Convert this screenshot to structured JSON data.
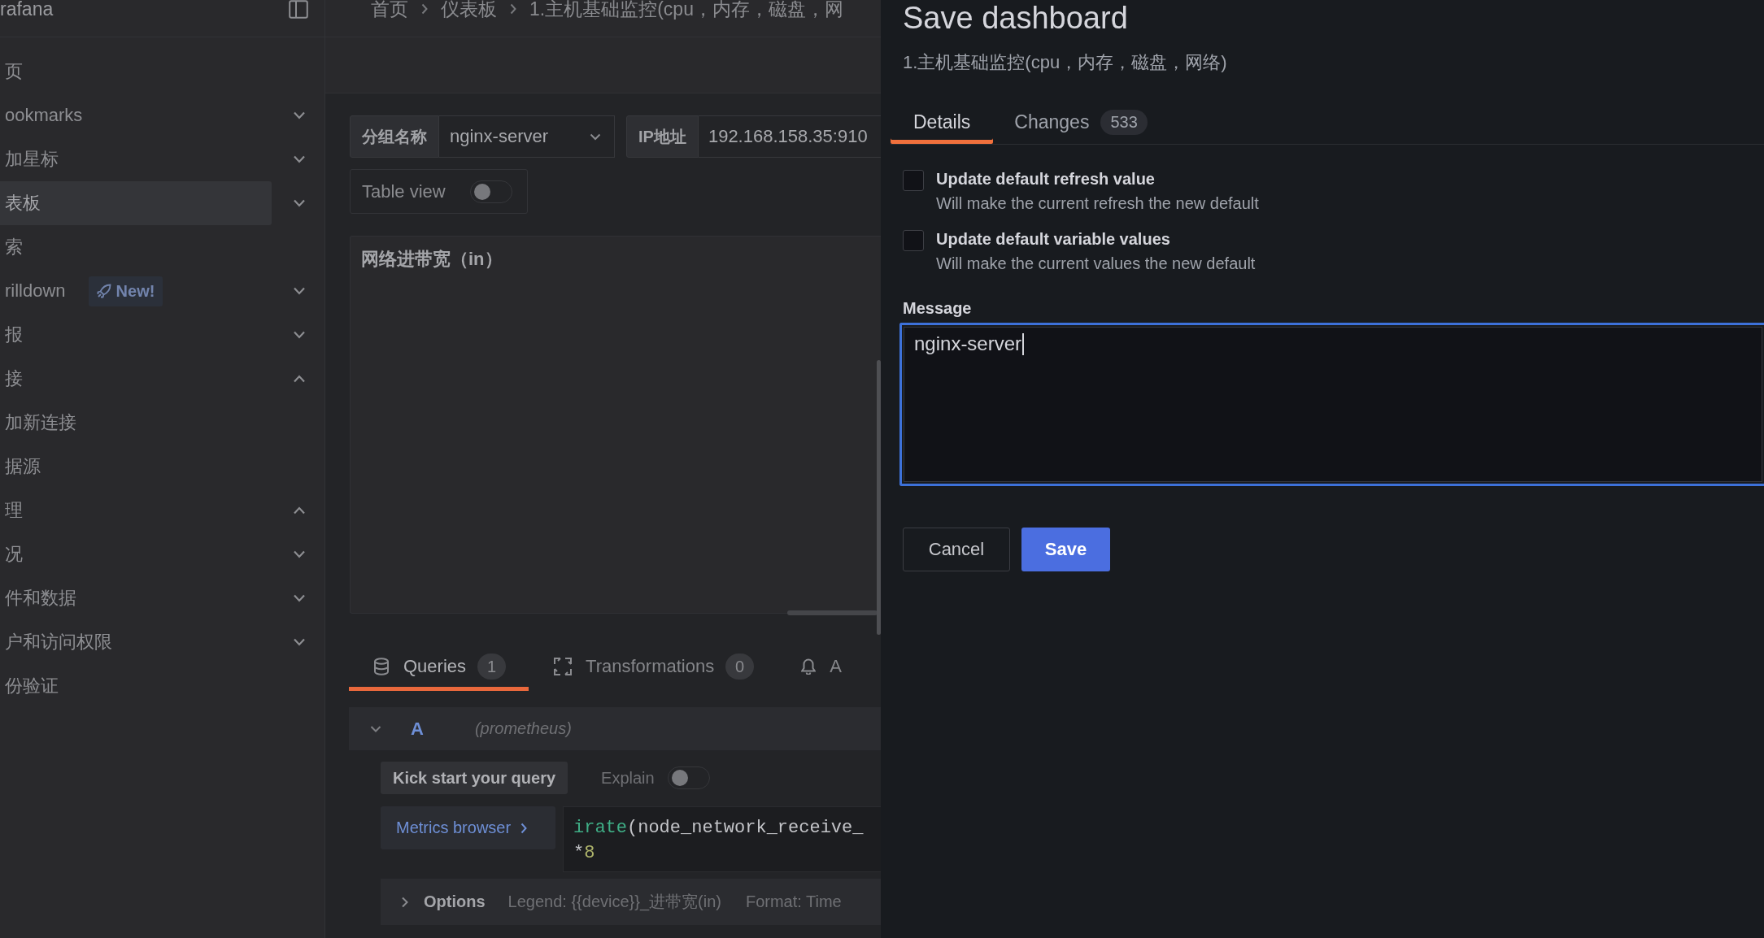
{
  "sidebar": {
    "brand": "rafana",
    "items": [
      {
        "label": "页",
        "selected": false
      },
      {
        "label": "ookmarks",
        "selected": false,
        "expanded": false
      },
      {
        "label": "加星标",
        "selected": false,
        "expanded": false
      },
      {
        "label": "表板",
        "selected": true,
        "expanded": false
      },
      {
        "label": "索",
        "selected": false
      },
      {
        "label": "rilldown",
        "selected": false,
        "expanded": false,
        "badge": "New!"
      },
      {
        "label": "报",
        "selected": false,
        "expanded": false
      },
      {
        "label": "接",
        "selected": false,
        "expanded": true,
        "children": [
          {
            "label": "加新连接",
            "selected": false
          },
          {
            "label": "据源",
            "selected": false
          }
        ]
      },
      {
        "label": "理",
        "selected": false,
        "expanded": true,
        "children": [
          {
            "label": "况",
            "selected": false,
            "expanded": false
          },
          {
            "label": "件和数据",
            "selected": false,
            "expanded": false
          },
          {
            "label": "户和访问权限",
            "selected": false,
            "expanded": false
          },
          {
            "label": "份验证",
            "selected": false
          }
        ]
      }
    ]
  },
  "breadcrumbs": [
    "首页",
    "仪表板",
    "1.主机基础监控(cpu，内存，磁盘，网"
  ],
  "variables": [
    {
      "kind": "dropdown",
      "label": "分组名称",
      "value": "nginx-server"
    },
    {
      "kind": "text",
      "label": "IP地址",
      "value": "192.168.158.35:910"
    }
  ],
  "table_view": {
    "label": "Table view",
    "on": false
  },
  "panel": {
    "title": "网络进带宽（in）"
  },
  "editor_tabs": [
    {
      "label": "Queries",
      "count": "1",
      "selected": true
    },
    {
      "label": "Transformations",
      "count": "0",
      "selected": false
    },
    {
      "label": "A",
      "selected": false
    }
  ],
  "query": {
    "ref": "A",
    "datasource": "(prometheus)",
    "expanded": true,
    "kick_start": "Kick start your query",
    "explain": {
      "label": "Explain",
      "on": false
    },
    "metrics_browser": "Metrics browser",
    "code": [
      [
        {
          "kind": "function",
          "text": "irate"
        },
        {
          "kind": "plain",
          "text": "(node_network_receive_"
        }
      ],
      [
        {
          "kind": "plain",
          "text": "*"
        },
        {
          "kind": "number",
          "text": "8"
        }
      ]
    ],
    "options": {
      "label": "Options",
      "expanded": false,
      "legend": "Legend: {{device}}_进带宽(in)",
      "format": "Format: Time"
    }
  },
  "drawer": {
    "title": "Save dashboard",
    "subtitle": "1.主机基础监控(cpu，内存，磁盘，网络)",
    "tabs": [
      {
        "label": "Details",
        "selected": true
      },
      {
        "label": "Changes",
        "count": "533",
        "selected": false
      }
    ],
    "options": [
      {
        "label": "Update default refresh value",
        "description": "Will make the current refresh the new default",
        "checked": false
      },
      {
        "label": "Update default variable values",
        "description": "Will make the current values the new default",
        "checked": false
      }
    ],
    "message": {
      "label": "Message",
      "value": "nginx-server",
      "focused": true
    },
    "buttons": [
      {
        "label": "Cancel",
        "kind": "secondary"
      },
      {
        "label": "Save",
        "kind": "primary"
      }
    ]
  }
}
